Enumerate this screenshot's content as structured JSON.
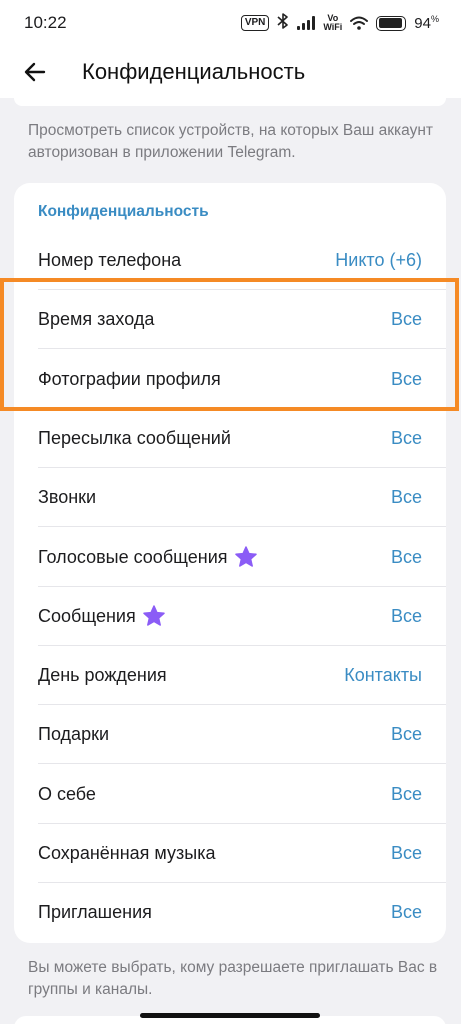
{
  "status_bar": {
    "time": "10:22",
    "vpn": "VPN",
    "vo": "Vo",
    "wifi_label": "WiFi",
    "battery_percent": "94",
    "battery_level": 0.94
  },
  "header": {
    "title": "Конфиденциальность",
    "back_icon": "arrow-back-icon"
  },
  "devices_hint": "Просмотреть список устройств, на которых Ваш аккаунт авторизован в приложении Telegram.",
  "privacy_section": {
    "header": "Конфиденциальность",
    "rows": [
      {
        "label": "Номер телефона",
        "value": "Никто (+6)",
        "star": false
      },
      {
        "label": "Время захода",
        "value": "Все",
        "star": false
      },
      {
        "label": "Фотографии профиля",
        "value": "Все",
        "star": false
      },
      {
        "label": "Пересылка сообщений",
        "value": "Все",
        "star": false
      },
      {
        "label": "Звонки",
        "value": "Все",
        "star": false
      },
      {
        "label": "Голосовые сообщения",
        "value": "Все",
        "star": true
      },
      {
        "label": "Сообщения",
        "value": "Все",
        "star": true
      },
      {
        "label": "День рождения",
        "value": "Контакты",
        "star": false
      },
      {
        "label": "Подарки",
        "value": "Все",
        "star": false
      },
      {
        "label": "О себе",
        "value": "Все",
        "star": false
      },
      {
        "label": "Сохранённая музыка",
        "value": "Все",
        "star": false
      },
      {
        "label": "Приглашения",
        "value": "Все",
        "star": false
      }
    ]
  },
  "invites_hint": "Вы можете выбрать, кому разрешаете приглашать Вас в группы и каналы.",
  "colors": {
    "accent": "#3a8cc3",
    "highlight": "#f58a25",
    "premium_star": "#8b5cf6"
  }
}
